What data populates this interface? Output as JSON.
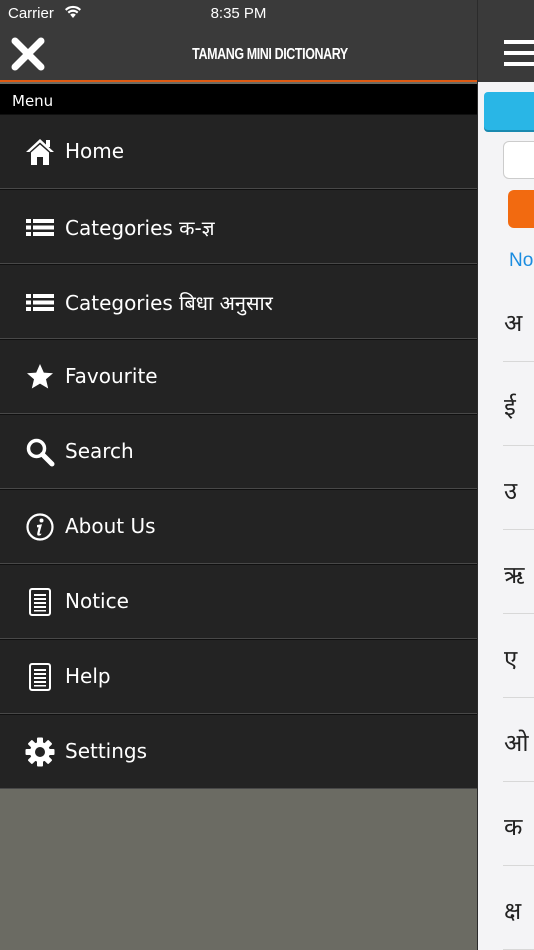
{
  "status_bar": {
    "carrier": "Carrier",
    "time": "8:35 PM"
  },
  "drawer": {
    "title": "TAMANG MINI DICTIONARY",
    "section_label": "Menu",
    "items": [
      {
        "label": "Home",
        "icon": "home-icon"
      },
      {
        "label": "Categories क-ज्ञ",
        "icon": "list-icon"
      },
      {
        "label": "Categories बिधा अनुसार",
        "icon": "list-icon"
      },
      {
        "label": "Favourite",
        "icon": "star-icon"
      },
      {
        "label": "Search",
        "icon": "search-icon"
      },
      {
        "label": "About Us",
        "icon": "info-icon"
      },
      {
        "label": "Notice",
        "icon": "document-icon"
      },
      {
        "label": "Help",
        "icon": "document-icon"
      },
      {
        "label": "Settings",
        "icon": "gear-icon"
      }
    ]
  },
  "main_peek": {
    "link_text": "No",
    "letters": [
      "अ",
      "ई",
      "उ",
      "ऋ",
      "ए",
      "ओ",
      "क",
      "क्ष"
    ]
  },
  "colors": {
    "accent": "#e05b13",
    "drawer_bg": "#232323",
    "header_bg": "#3a3a3a",
    "blue_button": "#29b6e6",
    "orange_button": "#f26a10",
    "link": "#1a8ce0"
  }
}
